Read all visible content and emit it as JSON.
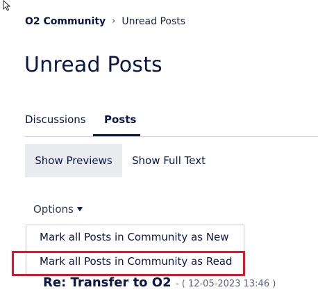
{
  "breadcrumb": {
    "home": "O2 Community",
    "separator": "›",
    "current": "Unread Posts"
  },
  "page_title": "Unread Posts",
  "tabs": [
    {
      "label": "Discussions",
      "active": false
    },
    {
      "label": "Posts",
      "active": true
    }
  ],
  "view_toggle": {
    "previews": "Show Previews",
    "full_text": "Show Full Text",
    "active": "previews"
  },
  "options": {
    "label": "Options",
    "menu_items": [
      {
        "label": "Mark all Posts in Community as New"
      },
      {
        "label": "Mark all Posts in Community as Read",
        "highlighted": true
      }
    ]
  },
  "post": {
    "title": "Re: Transfer to O2",
    "date": "- ( 12-05-2023 13:46 )"
  },
  "colors": {
    "text_primary": "#0a1645",
    "highlight": "#e0142b",
    "active_bg": "#e9ebef",
    "divider": "#cfd2d9"
  },
  "icons": {
    "cursor": "arrow-cursor-icon",
    "caret": "caret-down-icon",
    "separator": "chevron-right-icon"
  }
}
